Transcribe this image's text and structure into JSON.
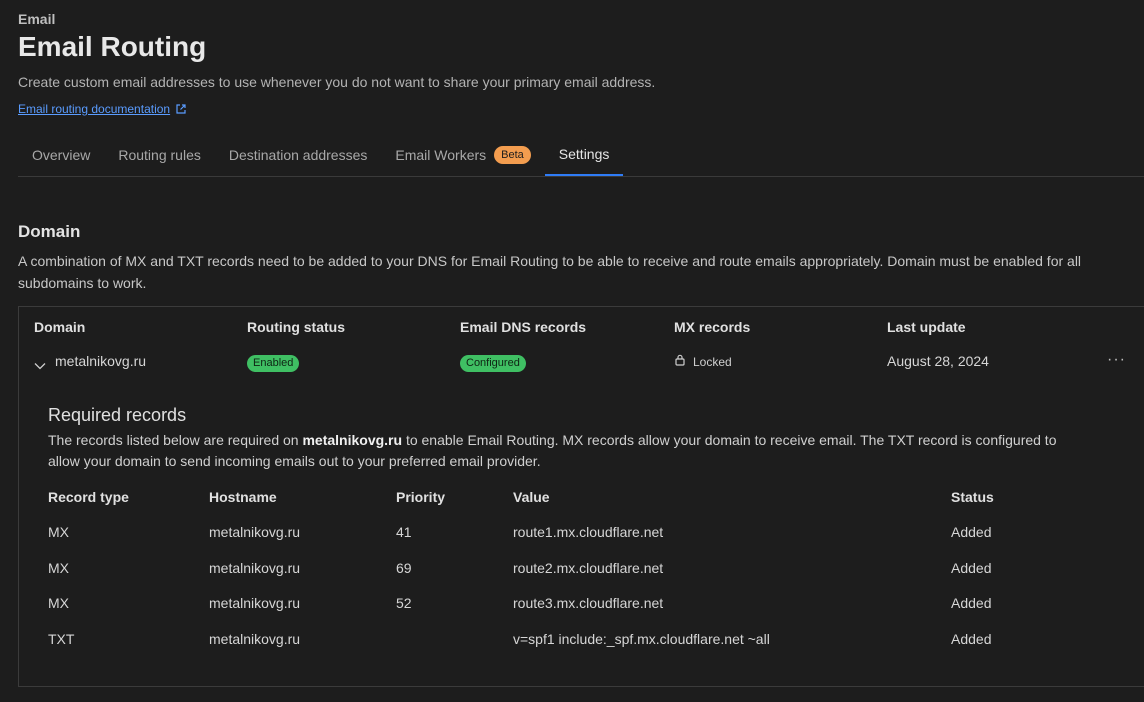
{
  "header": {
    "eyebrow": "Email",
    "title": "Email Routing",
    "subtitle": "Create custom email addresses to use whenever you do not want to share your primary email address.",
    "doc_link": "Email routing documentation"
  },
  "tabs": [
    {
      "label": "Overview"
    },
    {
      "label": "Routing rules"
    },
    {
      "label": "Destination addresses"
    },
    {
      "label": "Email Workers",
      "badge": "Beta"
    },
    {
      "label": "Settings",
      "active": true
    }
  ],
  "domain_section": {
    "title": "Domain",
    "description": "A combination of MX and TXT records need to be added to your DNS for Email Routing to be able to receive and route emails appropriately. Domain must be enabled for all subdomains to work.",
    "columns": [
      "Domain",
      "Routing status",
      "Email DNS records",
      "MX records",
      "Last update"
    ],
    "row": {
      "domain": "metalnikovg.ru",
      "routing_status": "Enabled",
      "dns_records": "Configured",
      "mx_records": "Locked",
      "last_update": "August 28, 2024"
    },
    "status_color": "#3fbf63"
  },
  "required": {
    "title": "Required records",
    "desc_prefix": "The records listed below are required on ",
    "desc_domain": "metalnikovg.ru",
    "desc_suffix": " to enable Email Routing. MX records allow your domain to receive email. The TXT record is configured to allow your domain to send incoming emails out to your preferred email provider.",
    "columns": [
      "Record type",
      "Hostname",
      "Priority",
      "Value",
      "Status"
    ],
    "rows": [
      {
        "type": "MX",
        "host": "metalnikovg.ru",
        "priority": "41",
        "value": "route1.mx.cloudflare.net",
        "status": "Added"
      },
      {
        "type": "MX",
        "host": "metalnikovg.ru",
        "priority": "69",
        "value": "route2.mx.cloudflare.net",
        "status": "Added"
      },
      {
        "type": "MX",
        "host": "metalnikovg.ru",
        "priority": "52",
        "value": "route3.mx.cloudflare.net",
        "status": "Added"
      },
      {
        "type": "TXT",
        "host": "metalnikovg.ru",
        "priority": "",
        "value": "v=spf1 include:_spf.mx.cloudflare.net ~all",
        "status": "Added"
      }
    ]
  },
  "icons": {
    "external_link": "external-link-icon",
    "chevron": "chevron-down-icon",
    "lock": "lock-icon",
    "more": "more-horizontal-icon"
  },
  "colors": {
    "accent": "#2f7cf6",
    "link": "#5a9cff",
    "beta_badge": "#f39d4f"
  }
}
